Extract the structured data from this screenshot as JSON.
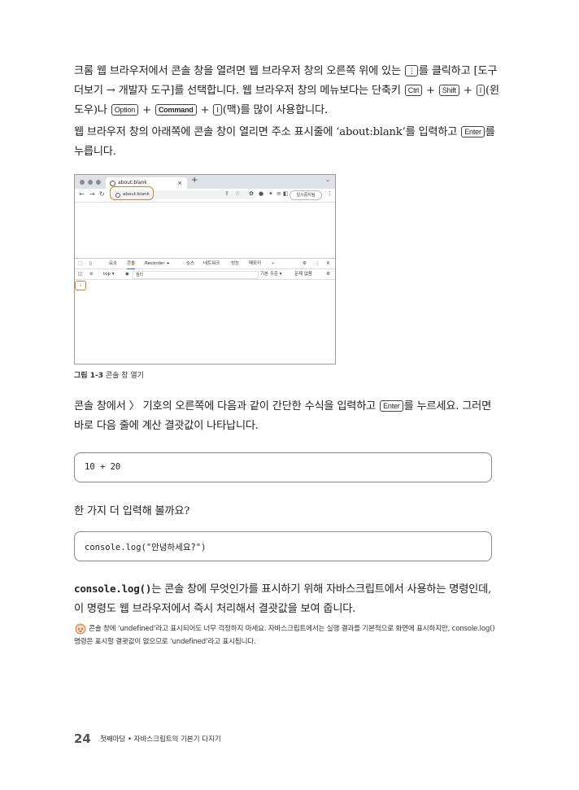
{
  "para1": {
    "a": "크롬 웹 브라우저에서 콘솔 창을 열려면 웹 브라우저 창의 오른쪽 위에 있는",
    "key_menu": "⋮",
    "b": "를 클릭하고 [도구 더보기 → 개발자 도구]를 선택합니다. 웹 브라우저 창의 메뉴보다는 단축키",
    "key_ctrl": "Ctrl",
    "plus": "+",
    "key_shift": "Shift",
    "key_i": "I",
    "c": "(윈도우)나",
    "key_option": "Option",
    "key_command": "Command",
    "d": "(맥)를 많이 사용합니다."
  },
  "para2": {
    "a": "웹 브라우저 창의 아래쪽에 콘솔 창이 열리면 주소 표시줄에 ‘about:blank’를 입력하고",
    "key_enter": "Enter",
    "b": "를 누릅니다."
  },
  "figure": {
    "tab_title": "about:blank",
    "tab_close": "×",
    "new_tab": "+",
    "url": "about:blank",
    "profile": "일시중지됨",
    "devtools_tabs": [
      "요소",
      "콘솔",
      "Recorder ⏶",
      "소스",
      "네트워크",
      "성능",
      "메모리",
      "»"
    ],
    "context": "top ▾",
    "filter_placeholder": "필터",
    "level": "기본 수준 ▾",
    "issues": "문제 없음",
    "prompt": "›"
  },
  "caption": {
    "label": "그림 1-3",
    "text": "콘솔 창 열기"
  },
  "para3": {
    "a": "콘솔 창에서 〉 기호의 오른쪽에 다음과 같이 간단한 수식을 입력하고",
    "key_enter": "Enter",
    "b": "를 누르세요. 그러면 바로 다음 줄에 계산 결괏값이 나타납니다."
  },
  "code1": "10 + 20",
  "para4": "한 가지 더 입력해 볼까요?",
  "code2": "console.log(\"안녕하세요?\")",
  "para5": {
    "code": "console.log()",
    "text": "는 콘솔 창에 무엇인가를 표시하기 위해 자바스크립트에서 사용하는 명령인데, 이 명령도 웹 브라우저에서 즉시 처리해서 결괏값을 보여 줍니다."
  },
  "note": "콘솔 창에 ‘undefined’라고 표시되어도 너무 걱정하지 마세요. 자바스크립트에서는 실행 결과를 기본적으로 화면에 표시하지만, console.log() 명령은 표시할 결괏값이 없으므로 ‘undefined’라고 표시됩니다.",
  "footer": {
    "page_number": "24",
    "title": "첫째마당 • 자바스크립트의 기본기 다지기"
  },
  "colors": {
    "highlight": "#e07b2a",
    "accent": "#1a73e8"
  }
}
